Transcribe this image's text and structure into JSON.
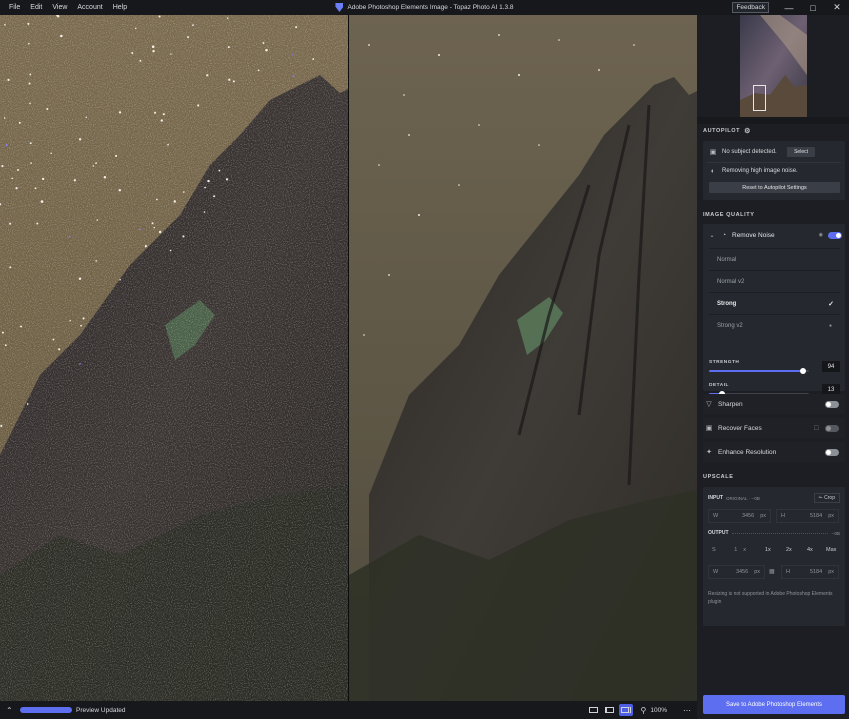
{
  "menu": [
    "File",
    "Edit",
    "View",
    "Account",
    "Help"
  ],
  "window": {
    "title": "Adobe Photoshop Elements Image - Topaz Photo AI 1.3.8",
    "feedback": "Feedback"
  },
  "bottombar": {
    "status": "Preview Updated",
    "zoom": "100%",
    "progress": 1.0
  },
  "autopilot": {
    "label": "AUTOPILOT",
    "subject_text": "No subject detected.",
    "select": "Select",
    "noise_text": "Removing high image noise.",
    "reset": "Reset to Autopilot Settings"
  },
  "image_quality": {
    "label": "IMAGE QUALITY",
    "remove_noise": "Remove Noise",
    "models": [
      "Normal",
      "Normal v2",
      "Strong",
      "Strong v2"
    ],
    "selected_model": "Strong",
    "strength_label": "STRENGTH",
    "strength": 94,
    "detail_label": "DETAIL",
    "detail": 13,
    "sharpen": "Sharpen",
    "recover_faces": "Recover Faces",
    "enhance_resolution": "Enhance Resolution"
  },
  "upscale": {
    "label": "UPSCALE",
    "input_label": "INPUT",
    "input_sub": "ORIGINAL · --0B",
    "crop": "Crop",
    "w_label": "W",
    "input_w": "3456",
    "h_label": "H",
    "input_h": "5184",
    "unit": "px",
    "output_label": "OUTPUT",
    "output_sub": "--0B",
    "s_label": "S",
    "scale": "1",
    "x": "x",
    "scales": [
      "1x",
      "2x",
      "4x",
      "Max"
    ],
    "output_w": "3456",
    "output_h": "5184",
    "note": "Resizing is not supported in Adobe Photoshop Elements plugin"
  },
  "save": "Save to Adobe Photoshop Elements"
}
